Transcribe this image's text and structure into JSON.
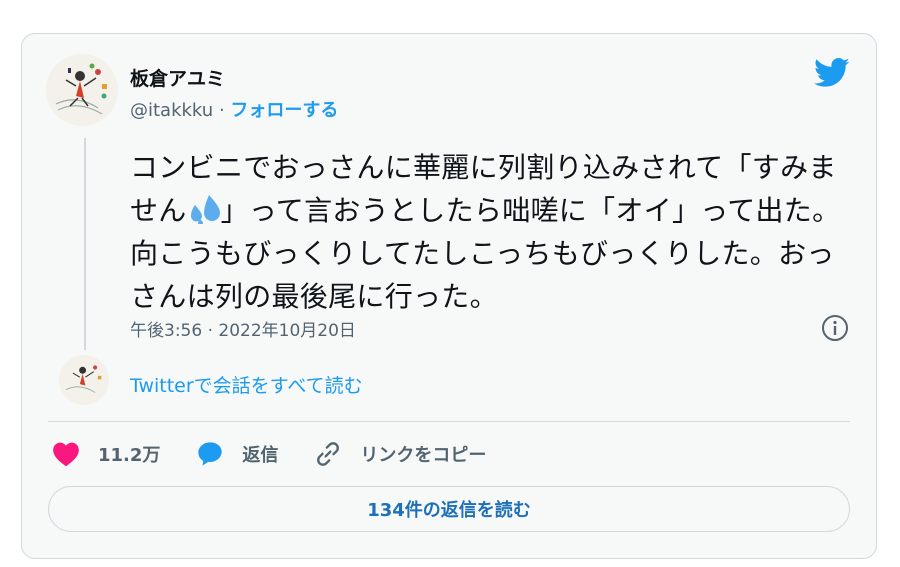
{
  "author": {
    "name": "板倉アユミ",
    "handle": "@itakkku",
    "separator": "·",
    "follow_label": "フォローする"
  },
  "tweet": {
    "text_before_emoji": "コンビニでおっさんに華麗に列割り込みされて「すみません",
    "text_after_emoji": "」って言おうとしたら咄嗟に「オイ」って出た。向こうもびっくりしてたしこっちもびっくりした。おっさんは列の最後尾に行った。",
    "emoji": "sweat-droplets-icon",
    "timestamp": "午後3:56 · 2022年10月20日"
  },
  "conversation_link": "Twitterで会話をすべて読む",
  "actions": {
    "likes_count": "11.2万",
    "reply_label": "返信",
    "copy_link_label": "リンクをコピー"
  },
  "read_replies_label": "134件の返信を読む",
  "colors": {
    "accent": "#1d9bf0",
    "like": "#f91880",
    "border": "#cfd9de",
    "muted": "#536471"
  },
  "icons": [
    "twitter-bird-icon",
    "info-icon",
    "heart-icon",
    "reply-bubble-icon",
    "link-icon"
  ]
}
